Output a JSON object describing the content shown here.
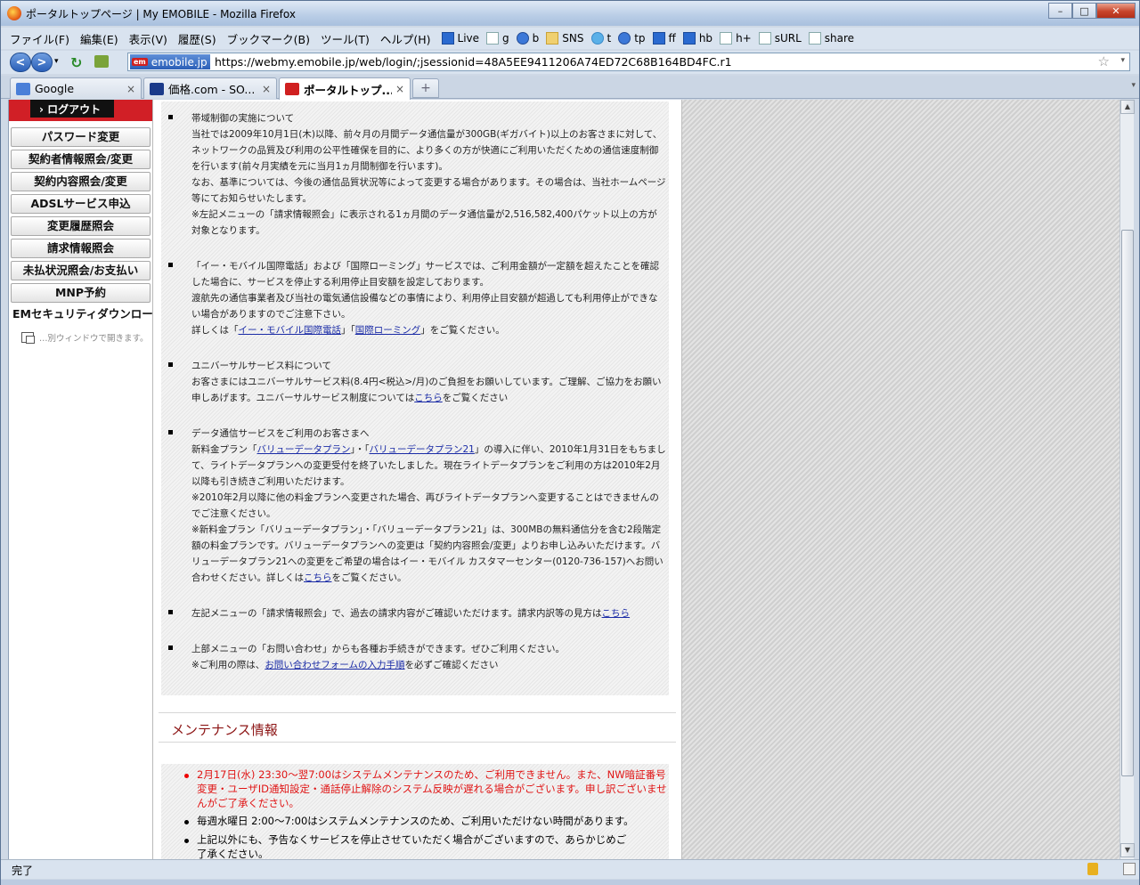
{
  "window": {
    "title": "ポータルトップページ | My EMOBILE - Mozilla Firefox",
    "min": "–",
    "max": "□",
    "close": "✕"
  },
  "menu": [
    "ファイル(F)",
    "編集(E)",
    "表示(V)",
    "履歴(S)",
    "ブックマーク(B)",
    "ツール(T)",
    "ヘルプ(H)"
  ],
  "bookmarks": [
    {
      "label": "Live",
      "icon": "windows-icon"
    },
    {
      "label": "g",
      "icon": "google-icon"
    },
    {
      "label": "b",
      "icon": "bing-icon"
    },
    {
      "label": "SNS",
      "icon": "folder-icon"
    },
    {
      "label": "t",
      "icon": "twitter-icon"
    },
    {
      "label": "tp",
      "icon": "target-icon"
    },
    {
      "label": "ff",
      "icon": "ff-icon"
    },
    {
      "label": "hb",
      "icon": "hatena-icon"
    },
    {
      "label": "h+",
      "icon": "page-icon"
    },
    {
      "label": "sURL",
      "icon": "page-icon"
    },
    {
      "label": "share",
      "icon": "page-icon"
    }
  ],
  "nav": {
    "back": "<",
    "forward": ">",
    "reload": "↻",
    "identity": "emobile.jp",
    "identity_badge": "em",
    "url": "https://webmy.emobile.jp/web/login/;jsessionid=48A5EE9411206A74ED72C68B164BD4FC.r1",
    "star": "☆",
    "dropdown": "▾"
  },
  "tabs": [
    {
      "label": "Google",
      "close": "×"
    },
    {
      "label": "価格.com - SO...",
      "close": "×"
    },
    {
      "label": "ポータルトップ...",
      "close": "×"
    }
  ],
  "newtab": "+",
  "tabscroll": "▾",
  "sidebar": {
    "logout": "› ログアウト",
    "buttons": [
      "パスワード変更",
      "契約者情報照会/変更",
      "契約内容照会/変更",
      "ADSLサービス申込",
      "変更履歴照会",
      "請求情報照会",
      "未払状況照会/お支払い",
      "MNP予約",
      "EMセキュリティダウンロード"
    ],
    "newwin_note": "…別ウィンドウで開きます。"
  },
  "notices": {
    "n1": {
      "l1": "帯域制御の実施について",
      "l2": "当社では2009年10月1日(木)以降、前々月の月間データ通信量が300GB(ギガバイト)以上のお客さまに対して、ネットワークの品質及び利用の公平性確保を目的に、より多くの方が快適にご利用いただくための通信速度制御を行います(前々月実績を元に当月1ヵ月間制御を行います)。",
      "l3": "なお、基準については、今後の通信品質状況等によって変更する場合があります。その場合は、当社ホームページ等にてお知らせいたします。",
      "l4": "※左記メニューの「請求情報照会」に表示される1ヵ月間のデータ通信量が2,516,582,400パケット以上の方が対象となります。"
    },
    "n2": {
      "l1": "「イー・モバイル国際電話」および「国際ローミング」サービスでは、ご利用金額が一定額を超えたことを確認した場合に、サービスを停止する利用停止目安額を設定しております。",
      "l2": "渡航先の通信事業者及び当社の電気通信設備などの事情により、利用停止目安額が超過しても利用停止ができない場合がありますのでご注意下さい。",
      "l3a": "詳しくは「",
      "link1": "イー・モバイル国際電話",
      "l3b": "」「",
      "link2": "国際ローミング",
      "l3c": "」をご覧ください。"
    },
    "n3": {
      "l1": "ユニバーサルサービス料について",
      "l2a": "お客さまにはユニバーサルサービス料(8.4円<税込>/月)のご負担をお願いしています。ご理解、ご協力をお願い申しあげます。ユニバーサルサービス制度については",
      "link": "こちら",
      "l2b": "をご覧ください"
    },
    "n4": {
      "l1": "データ通信サービスをご利用のお客さまへ",
      "l2a": "新料金プラン「",
      "link1": "バリューデータプラン",
      "l2b": "」・「",
      "link2": "バリューデータプラン21",
      "l2c": "」の導入に伴い、2010年1月31日をもちまして、ライトデータプランへの変更受付を終了いたしました。現在ライトデータプランをご利用の方は2010年2月以降も引き続きご利用いただけます。",
      "l3": "※2010年2月以降に他の料金プランへ変更された場合、再びライトデータプランへ変更することはできませんのでご注意ください。",
      "l4a": "※新料金プラン「バリューデータプラン」・「バリューデータプラン21」は、300MBの無料通信分を含む2段階定額の料金プランです。バリューデータプランへの変更は「契約内容照会/変更」よりお申し込みいただけます。バリューデータプラン21への変更をご希望の場合はイー・モバイル カスタマーセンター(0120-736-157)へお問い合わせください。詳しくは",
      "link3": "こちら",
      "l4b": "をご覧ください。"
    },
    "n5": {
      "l1a": "左記メニューの「請求情報照会」で、過去の請求内容がご確認いただけます。請求内訳等の見方は",
      "link": "こちら"
    },
    "n6": {
      "l1": "上部メニューの「お問い合わせ」からも各種お手続きができます。ぜひご利用ください。",
      "l2a": "※ご利用の際は、",
      "link": "お問い合わせフォームの入力手順",
      "l2b": "を必ずご確認ください"
    }
  },
  "maintenance": {
    "title": "メンテナンス情報",
    "items": [
      "2月17日(水) 23:30～翌7:00はシステムメンテナンスのため、ご利用できません。また、NW暗証番号変更・ユーザID通知設定・通話停止解除のシステム反映が遅れる場合がございます。申し訳ございませんがご了承ください。",
      "毎週水曜日 2:00～7:00はシステムメンテナンスのため、ご利用いただけない時間があります。",
      "上記以外にも、予告なくサービスを停止させていただく場合がございますので、あらかじめご了承ください。"
    ]
  },
  "scroll": {
    "up": "▲",
    "down": "▼"
  },
  "status": {
    "text": "完了"
  }
}
